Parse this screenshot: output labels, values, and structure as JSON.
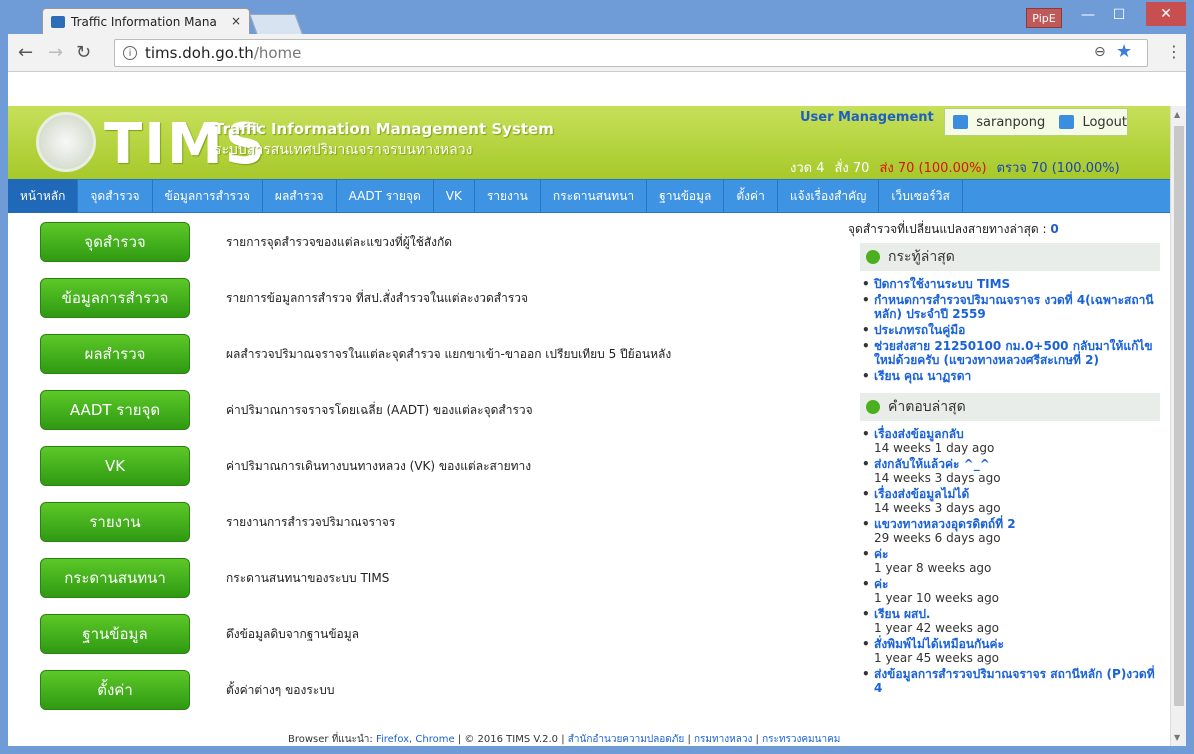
{
  "browser": {
    "tab_title": "Traffic Information Mana",
    "tab_close": "×",
    "url_host": "tims.doh.go.th",
    "url_path": "/home",
    "profile": "PipE",
    "zoom_icon": "⊖",
    "star_icon": "★",
    "menu_icon": "⋮"
  },
  "header": {
    "logo_text": "TIMS",
    "title_en": "Traffic Information Management System",
    "title_th": "ระบบสารสนเทศปริมาณจราจรบนทางหลวง",
    "user_mgmt": "User Management",
    "username": "saranpong",
    "logout": "Logout",
    "stat1": "งวด 4",
    "stat2": "สั่ง 70",
    "stat3": "ส่ง 70 (100.00%)",
    "stat4": "ตรวจ 70 (100.00%)"
  },
  "nav": [
    "หน้าหลัก",
    "จุดสำรวจ",
    "ข้อมูลการสำรวจ",
    "ผลสำรวจ",
    "AADT รายจุด",
    "VK",
    "รายงาน",
    "กระดานสนทนา",
    "ฐานข้อมูล",
    "ตั้งค่า",
    "แจ้งเรื่องสำคัญ",
    "เว็บเซอร์วิส"
  ],
  "menu": [
    {
      "label": "จุดสำรวจ",
      "desc": "รายการจุดสำรวจของแต่ละแขวงที่ผู้ใช้สังกัด"
    },
    {
      "label": "ข้อมูลการสำรวจ",
      "desc": "รายการข้อมูลการสำรวจ ที่สป.สั่งสำรวจในแต่ละงวดสำรวจ"
    },
    {
      "label": "ผลสำรวจ",
      "desc": "ผลสำรวจปริมาณจราจรในแต่ละจุดสำรวจ แยกขาเข้า-ขาออก เปรียบเทียบ 5 ปีย้อนหลัง"
    },
    {
      "label": "AADT รายจุด",
      "desc": "ค่าปริมาณการจราจรโดยเฉลี่ย (AADT) ของแต่ละจุดสำรวจ"
    },
    {
      "label": "VK",
      "desc": "ค่าปริมาณการเดินทางบนทางหลวง (VK) ของแต่ละสายทาง"
    },
    {
      "label": "รายงาน",
      "desc": "รายงานการสำรวจปริมาณจราจร"
    },
    {
      "label": "กระดานสนทนา",
      "desc": "กระดานสนทนาของระบบ TIMS"
    },
    {
      "label": "ฐานข้อมูล",
      "desc": "ดึงข้อมูลดิบจากฐานข้อมูล"
    },
    {
      "label": "ตั้งค่า",
      "desc": "ตั้งค่าต่างๆ ของระบบ"
    }
  ],
  "sidebar": {
    "changed_label": "จุดสำรวจที่เปลี่ยนแปลงสายทางล่าสุด :",
    "changed_count": "0",
    "topics_title": "กระทู้ล่าสุด",
    "topics": [
      "ปิดการใช้งานระบบ TIMS",
      "กำหนดการสำรวจปริมาณจราจร งวดที่ 4(เฉพาะสถานีหลัก) ประจำปี 2559",
      "ประเภทรถในคู่มือ",
      "ช่วยส่งสาย 21250100 กม.0+500 กลับมาให้แก้ไขใหม่ด้วยครับ (แขวงทางหลวงศรีสะเกษที่ 2)",
      "เรียน คุณ นาฏรดา"
    ],
    "replies_title": "คำตอบล่าสุด",
    "replies": [
      {
        "t": "เรื่องส่งข้อมูลกลับ",
        "a": "14 weeks 1 day ago"
      },
      {
        "t": "ส่งกลับให้แล้วค่ะ ^_^",
        "a": "14 weeks 3 days ago"
      },
      {
        "t": "เรื่องส่งข้อมูลไม่ได้",
        "a": "14 weeks 3 days ago"
      },
      {
        "t": "แขวงทางหลวงอุดรดิตถ์ที่ 2",
        "a": "29 weeks 6 days ago"
      },
      {
        "t": "ค่ะ",
        "a": "1 year 8 weeks ago"
      },
      {
        "t": "ค่ะ",
        "a": "1 year 10 weeks ago"
      },
      {
        "t": "เรียน ผสป.",
        "a": "1 year 42 weeks ago"
      },
      {
        "t": "สั่งพิมพ์ไม่ได้เหมือนกันค่ะ",
        "a": "1 year 45 weeks ago"
      },
      {
        "t": "ส่งข้อมูลการสำรวจปริมาณจราจร สถานีหลัก (P)งวดที่ 4",
        "a": ""
      }
    ]
  },
  "footer": {
    "prefix": "Browser ที่แนะนำ:",
    "browsers": "Firefox, Chrome",
    "copy": "| © 2016 TIMS V.2.0 |",
    "l1": "สำนักอำนวยความปลอดภัย",
    "sep": "|",
    "l2": "กรมทางหลวง",
    "l3": "กระทรวงคมนาคม"
  }
}
